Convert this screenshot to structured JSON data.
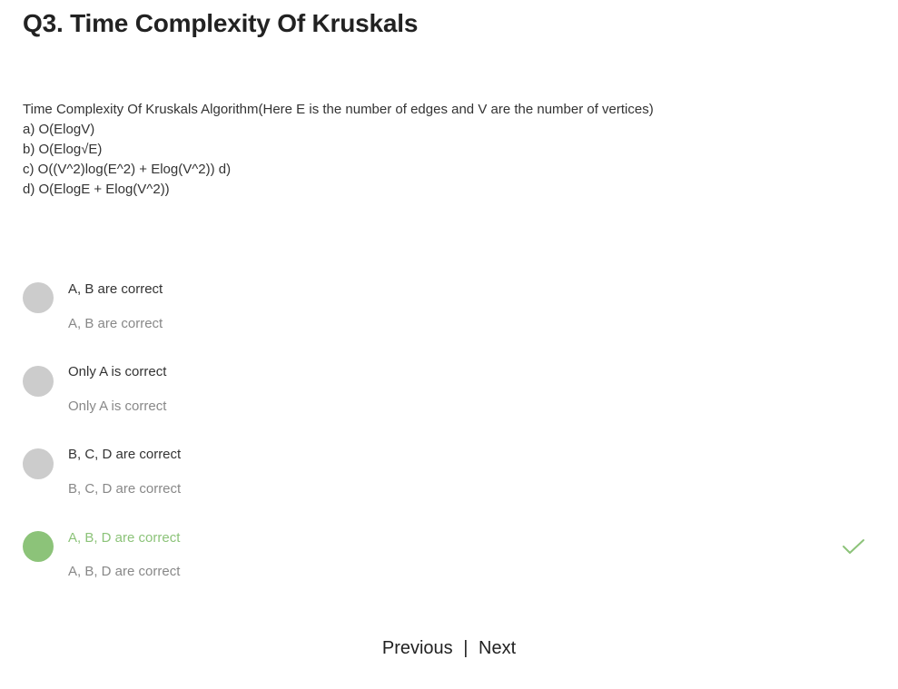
{
  "title": "Q3. Time Complexity Of Kruskals",
  "question": {
    "text": "Time Complexity Of Kruskals Algorithm(Here E is the number of edges and V are the number of vertices)",
    "choices": [
      "a) O(ElogV)",
      "b) O(Elog√E)",
      "c) O((V^2)log(E^2) + Elog(V^2)) d)",
      "d) O(ElogE + Elog(V^2))"
    ]
  },
  "options": [
    {
      "label": "A, B are correct",
      "explanation": "A, B are correct",
      "status": "neutral"
    },
    {
      "label": "Only A is correct",
      "explanation": "Only A is correct",
      "status": "neutral"
    },
    {
      "label": "B, C, D are correct",
      "explanation": "B, C, D are correct",
      "status": "neutral"
    },
    {
      "label": "A, B, D are correct",
      "explanation": "A, B, D are correct",
      "status": "correct",
      "indicator_icon": "check-icon"
    }
  ],
  "navigation": {
    "previous_label": "Previous",
    "separator": "|",
    "next_label": "Next"
  },
  "colors": {
    "correct": "#8cc379",
    "neutral_radio": "#cccccc",
    "explanation_text": "#888888"
  }
}
